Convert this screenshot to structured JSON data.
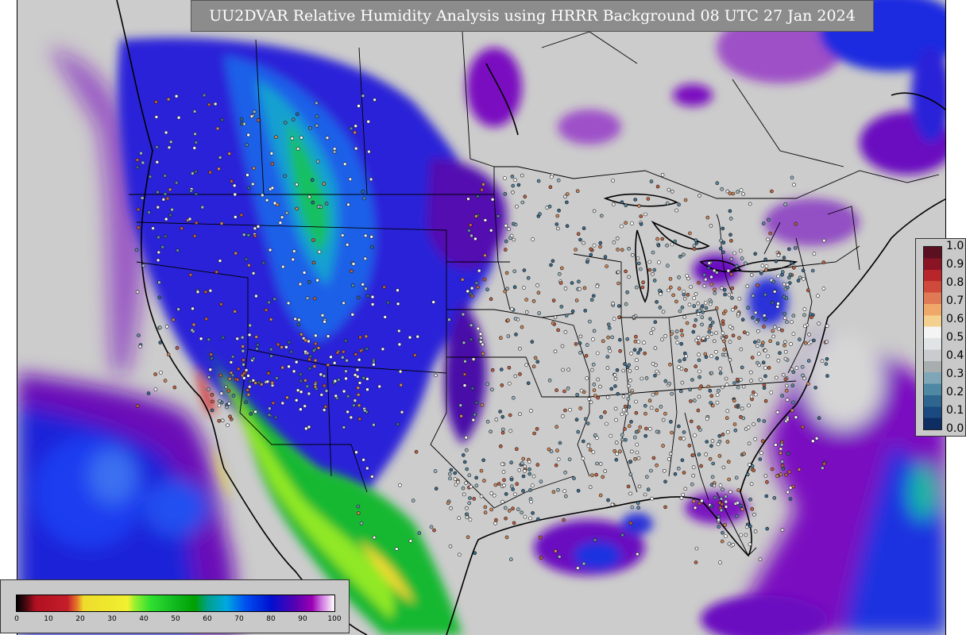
{
  "title": "UU2DVAR Relative Humidity Analysis using HRRR Background 08 UTC 27 Jan 2024",
  "colors": {
    "background_land": "#cccccc",
    "panel_gray": "#8c8c8c",
    "boundary": "#000000",
    "legend_bg": "#c9c9c9"
  },
  "ob_error_scale": {
    "ticks": [
      "1.0",
      "0.9",
      "0.8",
      "0.7",
      "0.6",
      "0.5",
      "0.4",
      "0.3",
      "0.2",
      "0.1",
      "0.0"
    ],
    "colors_top_to_bottom": [
      "#5a1020",
      "#8a1424",
      "#b8262c",
      "#cf4a3a",
      "#df7a55",
      "#f0a86a",
      "#f3d08e",
      "#f4f4f4",
      "#e0e4e6",
      "#c8ccce",
      "#a8adb0",
      "#7fa6b6",
      "#4f88a2",
      "#2e6690",
      "#1a4a80",
      "#0d2d63"
    ]
  },
  "rh_scale": {
    "ticks": [
      "0",
      "10",
      "20",
      "30",
      "40",
      "50",
      "60",
      "70",
      "80",
      "90",
      "100"
    ],
    "stops": [
      {
        "v": 0,
        "c": "#000000"
      },
      {
        "v": 3,
        "c": "#4a0a12"
      },
      {
        "v": 6,
        "c": "#b01020"
      },
      {
        "v": 16,
        "c": "#c41e2a"
      },
      {
        "v": 19,
        "c": "#e87a2a"
      },
      {
        "v": 21,
        "c": "#eedc2c"
      },
      {
        "v": 35,
        "c": "#f0f030"
      },
      {
        "v": 37,
        "c": "#9cf030"
      },
      {
        "v": 42,
        "c": "#30e030"
      },
      {
        "v": 50,
        "c": "#10b820"
      },
      {
        "v": 56,
        "c": "#00a000"
      },
      {
        "v": 60,
        "c": "#00a08a"
      },
      {
        "v": 66,
        "c": "#00a8e0"
      },
      {
        "v": 72,
        "c": "#0050f0"
      },
      {
        "v": 80,
        "c": "#0010d0"
      },
      {
        "v": 88,
        "c": "#5a00b0"
      },
      {
        "v": 93,
        "c": "#9a00b4"
      },
      {
        "v": 96,
        "c": "#d078e0"
      },
      {
        "v": 100,
        "c": "#ffffff"
      }
    ]
  },
  "icons": {
    "observation": "circle-marker"
  }
}
